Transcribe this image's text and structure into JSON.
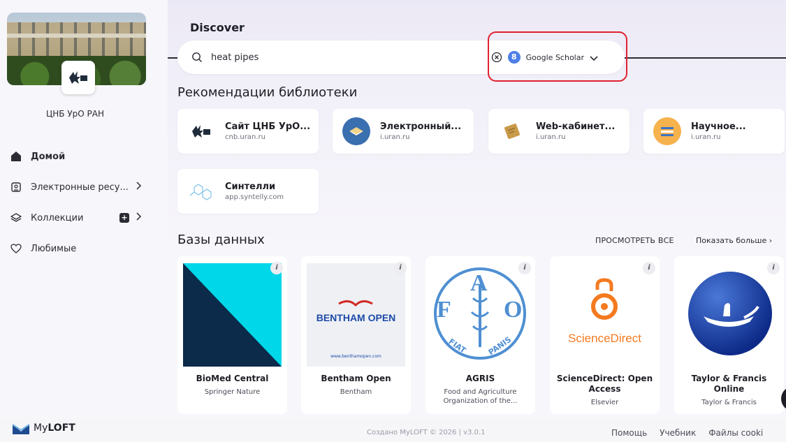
{
  "sidebar": {
    "library_name": "ЦНБ УрО РАН",
    "nav": [
      {
        "label": "Домой",
        "icon": "home-icon",
        "active": true
      },
      {
        "label": "Электронные ресу...",
        "icon": "resources-icon"
      },
      {
        "label": "Коллекции",
        "icon": "layers-icon"
      },
      {
        "label": "Любимые",
        "icon": "heart-icon"
      }
    ],
    "collections_badge": "+"
  },
  "header": {
    "title": "Discover"
  },
  "search": {
    "value": "heat pipes",
    "source_label": "Google Scholar",
    "source_badge": "8"
  },
  "recommendations": {
    "title": "Рекомендации библиотеки",
    "items": [
      {
        "title": "Сайт ЦНБ УрО...",
        "url": "cnb.uran.ru"
      },
      {
        "title": "Электронный...",
        "url": "i.uran.ru"
      },
      {
        "title": "Web-кабинет...",
        "url": "i.uran.ru"
      },
      {
        "title": "Научное...",
        "url": "i.uran.ru"
      },
      {
        "title": "Синтелли",
        "url": "app.syntelly.com"
      }
    ]
  },
  "databases": {
    "title": "Базы данных",
    "view_all": "ПРОСМОТРЕТЬ ВСЕ",
    "show_more": "Показать больше",
    "info_label": "i",
    "items": [
      {
        "name": "BioMed Central",
        "publisher": "Springer Nature"
      },
      {
        "name": "Bentham Open",
        "publisher": "Bentham",
        "logo_text": "BENTHAM OPEN",
        "logo_url": "www.benthamopen.com"
      },
      {
        "name": "AGRIS",
        "publisher": "Food and Agriculture Organization of the...",
        "logo_letters": [
          "F",
          "A",
          "O",
          "FIAT",
          "PANIS"
        ]
      },
      {
        "name": "ScienceDirect: Open Access",
        "publisher": "Elsevier",
        "logo_text": "ScienceDirect"
      },
      {
        "name": "Taylor & Francis Online",
        "publisher": "Taylor & Francis"
      }
    ]
  },
  "footer": {
    "brand_my": "My",
    "brand_loft": "LOFT",
    "copyright": "Создано MyLOFT © 2026 | v3.0.1",
    "links": [
      "Помощь",
      "Учебник",
      "Файлы cooki"
    ]
  },
  "colors": {
    "highlight": "#e0222e",
    "accent": "#4e7fe8",
    "text": "#1e1f26"
  }
}
